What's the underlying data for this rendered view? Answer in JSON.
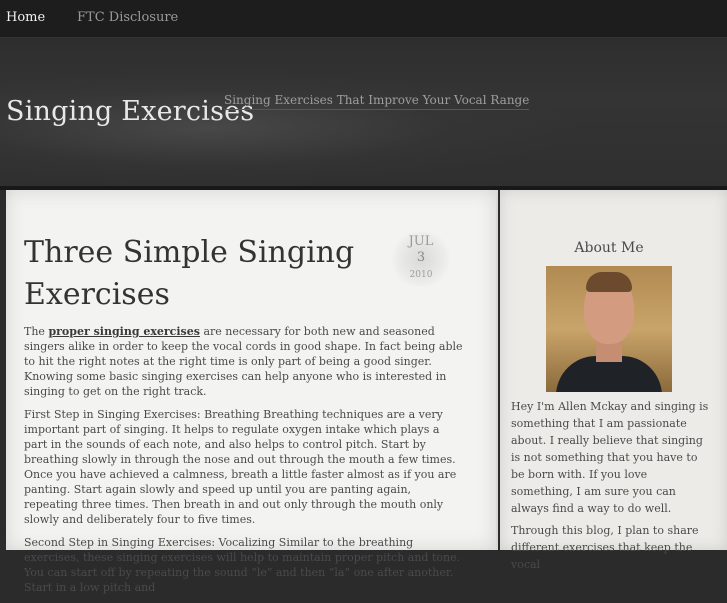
{
  "nav": {
    "items": [
      {
        "label": "Home"
      },
      {
        "label": "FTC Disclosure"
      }
    ]
  },
  "header": {
    "site_title": "Singing Exercises",
    "tagline": "Singing Exercises That Improve Your Vocal Range"
  },
  "post": {
    "title": "Three Simple Singing Exercises",
    "date": {
      "month": "JUL",
      "day": "3",
      "year": "2010"
    },
    "paragraphs": [
      {
        "link_text": "proper singing exercises",
        "before": "The ",
        "after": " are necessary for both new and seasoned singers alike in order to keep the vocal cords in good shape. In fact being able to hit the right notes at the right time is only part of being a good singer. Knowing some basic singing exercises can help anyone who is interested in singing to get on the right track."
      },
      {
        "text": "First Step in Singing Exercises: Breathing Breathing techniques are a very important part of singing. It helps to regulate oxygen intake which plays a part in the sounds of each note, and also helps to control pitch. Start by breathing slowly in through the nose and out through the mouth a few times. Once you have achieved a calmness, breath a little faster almost as if you are panting. Start again slowly and speed up until you are panting again, repeating three times. Then breath in and out only through the mouth only slowly and deliberately four to five times."
      },
      {
        "text": "Second Step in Singing Exercises: Vocalizing Similar to the breathing exercises, these singing exercises will help to maintain proper pitch and tone. You can start off by repeating the sound “le” and then “la” one after another. Start in a low pitch and"
      }
    ]
  },
  "sidebar": {
    "about_title": "About Me",
    "about_paragraphs": [
      "Hey I'm Allen Mckay and singing is something that I am passionate about. I really believe that singing is not something that you have to be born with. If you love something, I am sure you can always find a way to do well.",
      "Through this blog, I plan to share different exercises that keep the vocal"
    ]
  }
}
